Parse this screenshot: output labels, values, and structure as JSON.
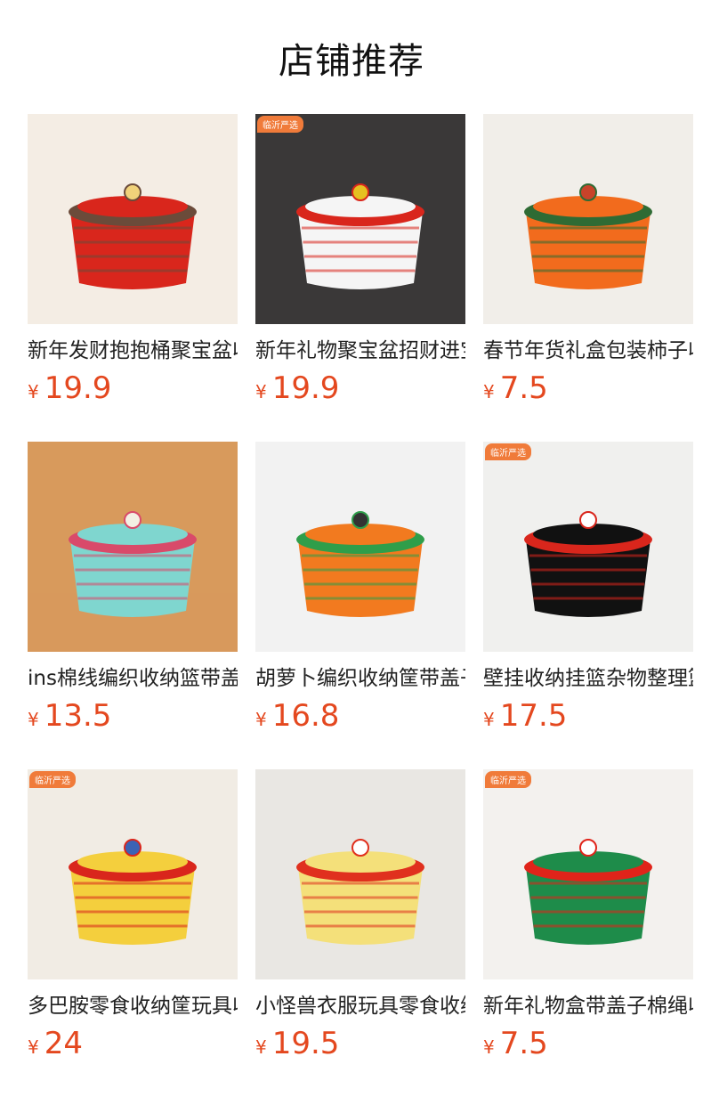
{
  "page": {
    "title": "店铺推荐"
  },
  "products": [
    {
      "name": "新年发财抱抱桶聚宝盆收纳桶",
      "currency": "¥",
      "price": "19.9",
      "badge": "",
      "bg": "#f4ede4",
      "main": "#d9261c",
      "accent": "#6b4b3a",
      "extra": "#f0d27a"
    },
    {
      "name": "新年礼物聚宝盆招财进宝收纳盆",
      "currency": "¥",
      "price": "19.9",
      "badge": "临沂严选",
      "bg": "#3a3838",
      "main": "#f5f5f5",
      "accent": "#d9261c",
      "extra": "#e6c021"
    },
    {
      "name": "春节年货礼盒包装柿子收纳篮",
      "currency": "¥",
      "price": "7.5",
      "badge": "",
      "bg": "#f1eee9",
      "main": "#f26b1d",
      "accent": "#2f6b34",
      "extra": "#c8432a"
    },
    {
      "name": "ins棉线编织收纳篮带盖子",
      "currency": "¥",
      "price": "13.5",
      "badge": "",
      "bg": "#d89a5c",
      "main": "#7fd6cf",
      "accent": "#d94a6a",
      "extra": "#f3efe4"
    },
    {
      "name": "胡萝卜编织收纳筐带盖子收纳盒",
      "currency": "¥",
      "price": "16.8",
      "badge": "",
      "bg": "#f2f2f2",
      "main": "#f27a1f",
      "accent": "#2f9e4a",
      "extra": "#333333"
    },
    {
      "name": "壁挂收纳挂篮杂物整理篮",
      "currency": "¥",
      "price": "17.5",
      "badge": "临沂严选",
      "bg": "#f0f0ee",
      "main": "#111111",
      "accent": "#d9261c",
      "extra": "#ffffff"
    },
    {
      "name": "多巴胺零食收纳筐玩具收纳篮",
      "currency": "¥",
      "price": "24",
      "badge": "临沂严选",
      "bg": "#f1ece4",
      "main": "#f4cf3d",
      "accent": "#d9261c",
      "extra": "#3b63b4"
    },
    {
      "name": "小怪兽衣服玩具零食收纳筐",
      "currency": "¥",
      "price": "19.5",
      "badge": "",
      "bg": "#e9e7e3",
      "main": "#f4e07a",
      "accent": "#e0301e",
      "extra": "#ffffff"
    },
    {
      "name": "新年礼物盒带盖子棉绳收纳篮",
      "currency": "¥",
      "price": "7.5",
      "badge": "临沂严选",
      "bg": "#f3f1ee",
      "main": "#1e8c4a",
      "accent": "#e0241a",
      "extra": "#ffffff"
    }
  ]
}
